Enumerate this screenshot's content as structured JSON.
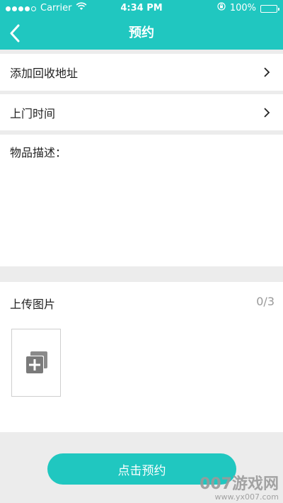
{
  "status_bar": {
    "carrier": "Carrier",
    "time": "4:34 PM",
    "battery": "100%",
    "icons": [
      "signal-icon",
      "wifi-icon",
      "orientation-lock-icon",
      "battery-icon"
    ]
  },
  "nav": {
    "title": "预约",
    "back_icon": "back-chevron-icon"
  },
  "rows": {
    "address_label": "添加回收地址",
    "time_label": "上门时间"
  },
  "description": {
    "label": "物品描述："
  },
  "upload": {
    "label": "上传图片",
    "count": "0/3",
    "add_icon": "add-image-icon"
  },
  "submit": {
    "label": "点击预约"
  },
  "watermark": {
    "line1": "007游戏网",
    "line2": "www.yx007.com"
  },
  "colors": {
    "accent": "#20c7c0",
    "background": "#ececec",
    "count_text": "#999999"
  }
}
